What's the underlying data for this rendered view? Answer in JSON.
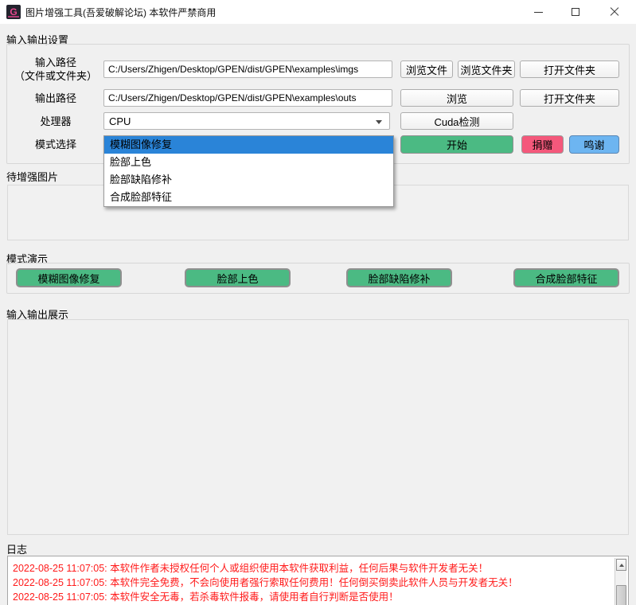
{
  "titlebar": {
    "title": "图片增强工具(吾爱破解论坛) 本软件严禁商用",
    "app_icon_letter": "G"
  },
  "io_settings": {
    "group_label": "输入输出设置",
    "input_row": {
      "label_line1": "输入路径",
      "label_line2": "（文件或文件夹）",
      "value": "C:/Users/Zhigen/Desktop/GPEN/dist/GPEN\\examples\\imgs",
      "browse_file_label": "浏览文件",
      "browse_folder_label": "浏览文件夹",
      "open_folder_label": "打开文件夹"
    },
    "output_row": {
      "label": "输出路径",
      "value": "C:/Users/Zhigen/Desktop/GPEN/dist/GPEN\\examples\\outs",
      "browse_label": "浏览",
      "open_folder_label": "打开文件夹"
    },
    "processor_row": {
      "label": "处理器",
      "selected_value": "CPU",
      "cuda_check_label": "Cuda检测"
    },
    "mode_row": {
      "label": "模式选择",
      "start_label": "开始",
      "donate_label": "捐赠",
      "thanks_label": "鸣谢"
    }
  },
  "mode_dropdown": {
    "options": [
      "模糊图像修复",
      "脸部上色",
      "脸部缺陷修补",
      "合成脸部特征"
    ],
    "selected_index": 0,
    "highlight_color": "#2a84d8"
  },
  "pending_section": {
    "label": "待增强图片"
  },
  "demo_section": {
    "label": "模式演示",
    "buttons": [
      "模糊图像修复",
      "脸部上色",
      "脸部缺陷修补",
      "合成脸部特征"
    ]
  },
  "display_section": {
    "label": "输入输出展示"
  },
  "log_section": {
    "label": "日志",
    "text_color": "#ff1a1a",
    "entries": [
      "2022-08-25 11:07:05: 本软件作者未授权任何个人或组织使用本软件获取利益，任何后果与软件开发者无关！",
      "2022-08-25 11:07:05: 本软件完全免费，不会向使用者强行索取任何费用！任何倒买倒卖此软件人员与开发者无关！",
      "2022-08-25 11:07:05: 本软件安全无毒，若杀毒软件报毒，请使用者自行判断是否使用！"
    ]
  },
  "colors": {
    "accent_green": "#4bba83",
    "accent_pink": "#f4587b",
    "accent_blue": "#6db5f1",
    "log_red": "#ff1a1a",
    "selection_blue": "#2a84d8"
  }
}
